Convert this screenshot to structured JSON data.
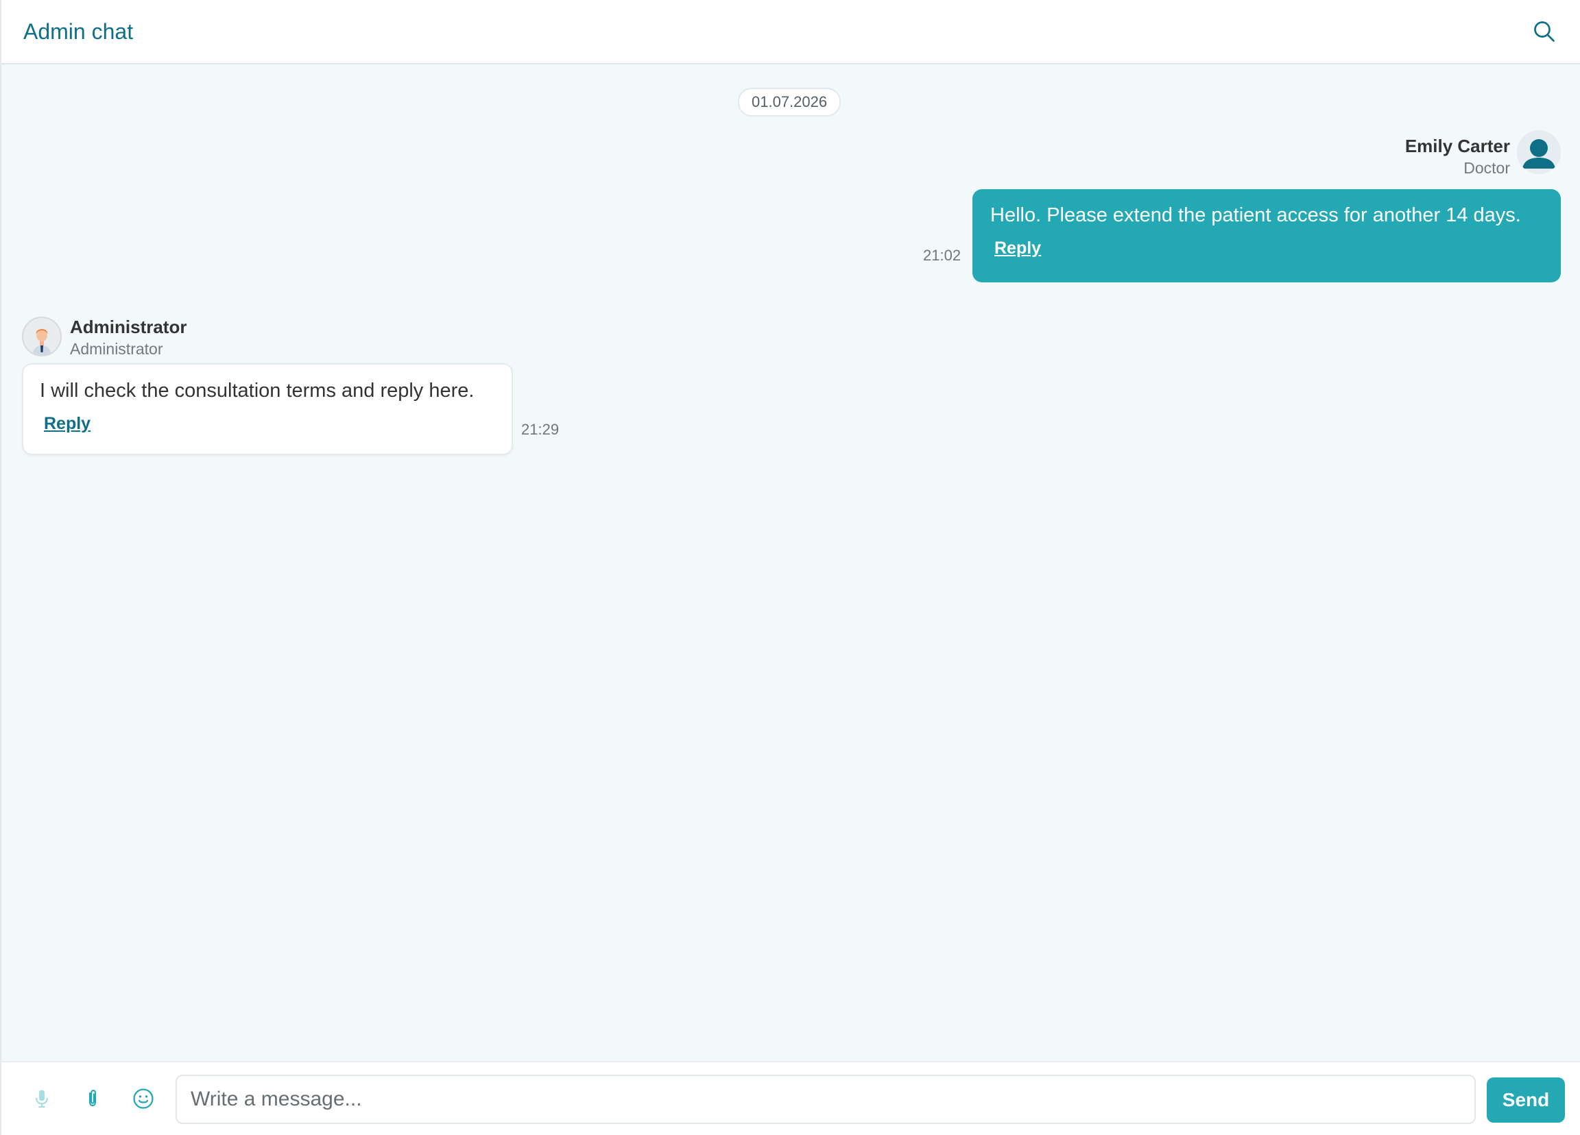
{
  "header": {
    "title": "Admin chat",
    "search_icon": "search-icon"
  },
  "chat": {
    "date": "01.07.2026",
    "messages": [
      {
        "direction": "outgoing",
        "sender_name": "Emily Carter",
        "sender_role": "Doctor",
        "avatar_icon": "user-silhouette-icon",
        "text": "Hello. Please extend the patient access for another 14 days.",
        "reply_label": "Reply",
        "time": "21:02"
      },
      {
        "direction": "incoming",
        "sender_name": "Administrator",
        "sender_role": "Administrator",
        "avatar_icon": "admin-avatar-icon",
        "text": "I will check the consultation terms and reply here.",
        "reply_label": "Reply",
        "time": "21:29"
      }
    ]
  },
  "composer": {
    "placeholder": "Write a message...",
    "value": "",
    "send_label": "Send",
    "tools": [
      "microphone-icon",
      "paperclip-icon",
      "emoji-icon"
    ]
  },
  "colors": {
    "accent": "#24a8b4",
    "title": "#0e6f86",
    "background": "#f3f8fa"
  }
}
